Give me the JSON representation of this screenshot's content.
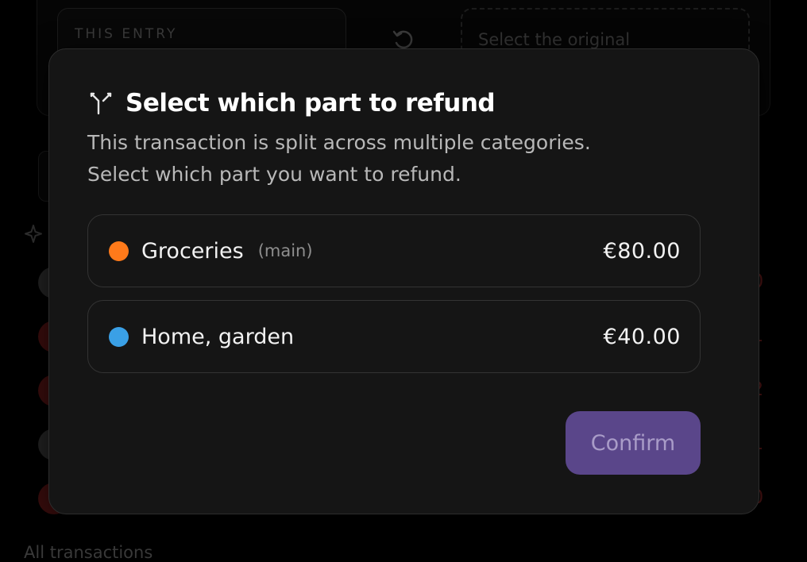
{
  "background": {
    "entry_label": "THIS ENTRY",
    "select_placeholder": "Select the original",
    "amounts": [
      "0",
      "1",
      "2",
      "1",
      "0"
    ],
    "all_transactions_label": "All transactions"
  },
  "modal": {
    "icon": "split-icon",
    "title": "Select which part to refund",
    "description_line1": "This transaction is split across multiple categories.",
    "description_line2": "Select which part you want to refund.",
    "options": [
      {
        "name": "Groceries",
        "tag": "(main)",
        "amount": "€80.00",
        "color": "#FF7A1A"
      },
      {
        "name": "Home, garden",
        "tag": "",
        "amount": "€40.00",
        "color": "#3AA0E6"
      }
    ],
    "confirm_label": "Confirm"
  },
  "colors": {
    "modal_bg": "#151515",
    "accent_button": "#5A468A",
    "groceries": "#FF7A1A",
    "home_garden": "#3AA0E6"
  }
}
